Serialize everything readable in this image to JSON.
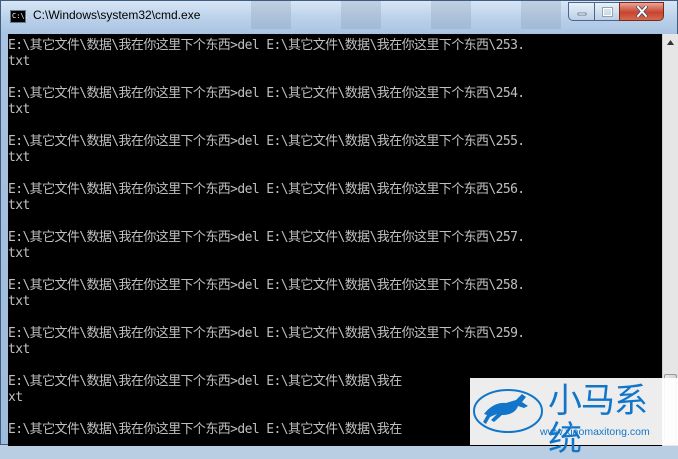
{
  "window": {
    "title": "C:\\Windows\\system32\\cmd.exe",
    "icon": "cmd-console-icon",
    "icon_text": "C:\\."
  },
  "controls": {
    "minimize": "minimize-icon",
    "maximize": "maximize-icon",
    "close": "close-icon"
  },
  "console": {
    "lines": [
      "E:\\其它文件\\数据\\我在你这里下个东西>del E:\\其它文件\\数据\\我在你这里下个东西\\253.",
      "txt",
      "",
      "E:\\其它文件\\数据\\我在你这里下个东西>del E:\\其它文件\\数据\\我在你这里下个东西\\254.",
      "txt",
      "",
      "E:\\其它文件\\数据\\我在你这里下个东西>del E:\\其它文件\\数据\\我在你这里下个东西\\255.",
      "txt",
      "",
      "E:\\其它文件\\数据\\我在你这里下个东西>del E:\\其它文件\\数据\\我在你这里下个东西\\256.",
      "txt",
      "",
      "E:\\其它文件\\数据\\我在你这里下个东西>del E:\\其它文件\\数据\\我在你这里下个东西\\257.",
      "txt",
      "",
      "E:\\其它文件\\数据\\我在你这里下个东西>del E:\\其它文件\\数据\\我在你这里下个东西\\258.",
      "txt",
      "",
      "E:\\其它文件\\数据\\我在你这里下个东西>del E:\\其它文件\\数据\\我在你这里下个东西\\259.",
      "txt",
      "",
      "E:\\其它文件\\数据\\我在你这里下个东西>del E:\\其它文件\\数据\\我在",
      "xt",
      "",
      "E:\\其它文件\\数据\\我在你这里下个东西>del E:\\其它文件\\数据\\我在"
    ],
    "text_color": "#c0c0c0",
    "background": "#000000"
  },
  "watermark": {
    "brand": "小马系统",
    "url": "www.xiaomaxitong.com",
    "color": "#1176c9",
    "logo": "horse-logo-icon"
  }
}
